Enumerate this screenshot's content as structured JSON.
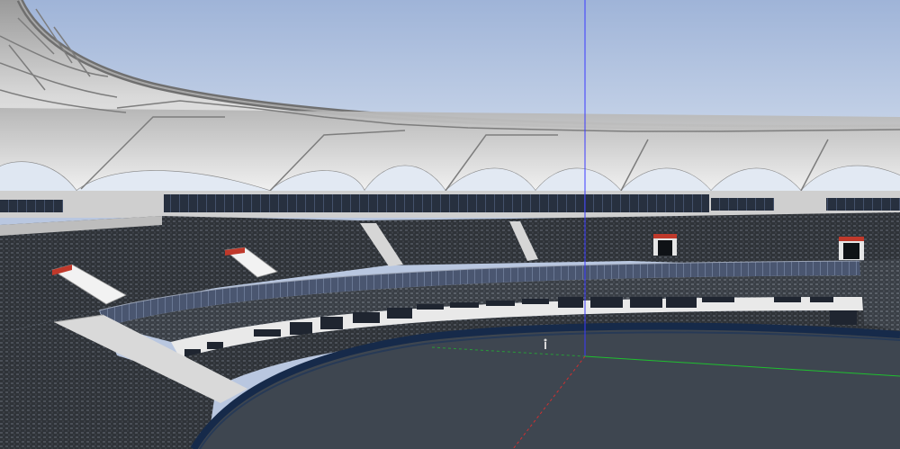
{
  "scene": {
    "subject": "stadium-3d-model-viewport",
    "palette": {
      "sky_top": "#9fb4d8",
      "sky_bottom": "#dfe7f2",
      "roof_light": "#f1f1f1",
      "roof_shadow": "#a9a9a9",
      "truss": "#7d7d7d",
      "seats_dark": "#2f3338",
      "seats_mid": "#4a4f57",
      "concrete": "#cfcfcf",
      "glass_band": "#2a3444",
      "field": "#3e4650",
      "field_edge": "#162a4a",
      "accent_red": "#c0392b",
      "axis_blue": "#3a3aff",
      "axis_green": "#1fbf2f",
      "axis_red": "#d03030"
    },
    "axes": [
      "blue-vertical-axis",
      "green-horizontal-axis",
      "red-horizontal-axis"
    ]
  }
}
